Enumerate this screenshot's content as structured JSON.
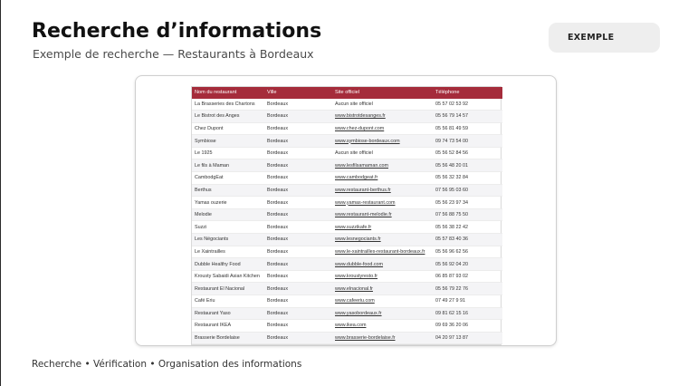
{
  "header": {
    "title": "Recherche d’informations",
    "subtitle": "Exemple de recherche — Restaurants à Bordeaux",
    "badge": "EXEMPLE"
  },
  "table": {
    "columns": [
      "Nom du restaurant",
      "Ville",
      "Site officiel",
      "Téléphone"
    ],
    "rows": [
      {
        "name": "La Brasseries des Chartons",
        "city": "Bordeaux",
        "site": "Aucun site officiel",
        "phone": "05 57 02 53 92",
        "link": false
      },
      {
        "name": "Le Bistrot des Anges",
        "city": "Bordeaux",
        "site": "www.bistrotdesanges.fr",
        "phone": "05 56 79 14 57",
        "link": true
      },
      {
        "name": "Chez Dupont",
        "city": "Bordeaux",
        "site": "www.chez-dupont.com",
        "phone": "05 56 81 49 59",
        "link": true
      },
      {
        "name": "Symbiose",
        "city": "Bordeaux",
        "site": "www.symbiose-bordeaux.com",
        "phone": "09 74 73 54 00",
        "link": true
      },
      {
        "name": "Le 1925",
        "city": "Bordeaux",
        "site": "Aucun site officiel",
        "phone": "05 56 52 84 56",
        "link": false
      },
      {
        "name": "Le fils à Maman",
        "city": "Bordeaux",
        "site": "www.lesfilsamaman.com",
        "phone": "05 56 48 20 01",
        "link": true
      },
      {
        "name": "CambodgEat",
        "city": "Bordeaux",
        "site": "www.cambodgeat.fr",
        "phone": "05 56 32 32 84",
        "link": true
      },
      {
        "name": "Berthus",
        "city": "Bordeaux",
        "site": "www.restaurant-berthus.fr",
        "phone": "07 56 95 03 60",
        "link": true
      },
      {
        "name": "Yamas ouzerie",
        "city": "Bordeaux",
        "site": "www.yamas-restaurant.com",
        "phone": "05 56 23 97 34",
        "link": true
      },
      {
        "name": "Melodie",
        "city": "Bordeaux",
        "site": "www.restaurant-melodie.fr",
        "phone": "07 56 88 75 50",
        "link": true
      },
      {
        "name": "Suzzi",
        "city": "Bordeaux",
        "site": "www.suzzikafe.fr",
        "phone": "05 56 38 22 42",
        "link": true
      },
      {
        "name": "Les Négociants",
        "city": "Bordeaux",
        "site": "www.lesnegociants.fr",
        "phone": "05 57 83 40 36",
        "link": true
      },
      {
        "name": "Le Xaintrailles",
        "city": "Bordeaux",
        "site": "www.le-xaintrailles-restaurant-bordeaux.fr",
        "phone": "05 56 96 62 56",
        "link": true
      },
      {
        "name": "Dubble Healthy Food",
        "city": "Bordeaux",
        "site": "www.dubble-food.com",
        "phone": "05 56 92 04 20",
        "link": true
      },
      {
        "name": "Krousty Sabaidi Asian Kitchen",
        "city": "Bordeaux",
        "site": "www.kroustyresto.fr",
        "phone": "06 85 87 93 02",
        "link": true
      },
      {
        "name": "Restaurant El Nacional",
        "city": "Bordeaux",
        "site": "www.elnacional.fr",
        "phone": "05 56 79 22 76",
        "link": true
      },
      {
        "name": "Café Eriu",
        "city": "Bordeaux",
        "site": "www.cafeeriu.com",
        "phone": "07 49 27 9 91",
        "link": true
      },
      {
        "name": "Restaurant Yaso",
        "city": "Bordeaux",
        "site": "www.yasobordeaux.fr",
        "phone": "09 81 62 15 16",
        "link": true
      },
      {
        "name": "Restaurant IKEA",
        "city": "Bordeaux",
        "site": "www.ikea.com",
        "phone": "09 69 36 20 06",
        "link": true
      },
      {
        "name": "Brasserie Bordelaise",
        "city": "Bordeaux",
        "site": "www.brasserie-bordelaise.fr",
        "phone": "04 20 97 13 87",
        "link": true
      }
    ]
  },
  "footer": {
    "text": "Recherche • Vérification • Organisation des informations"
  },
  "colors": {
    "header_bg": "#a52c3b",
    "row_alt": "#f4f4f6",
    "badge_bg": "#eeeeee"
  }
}
